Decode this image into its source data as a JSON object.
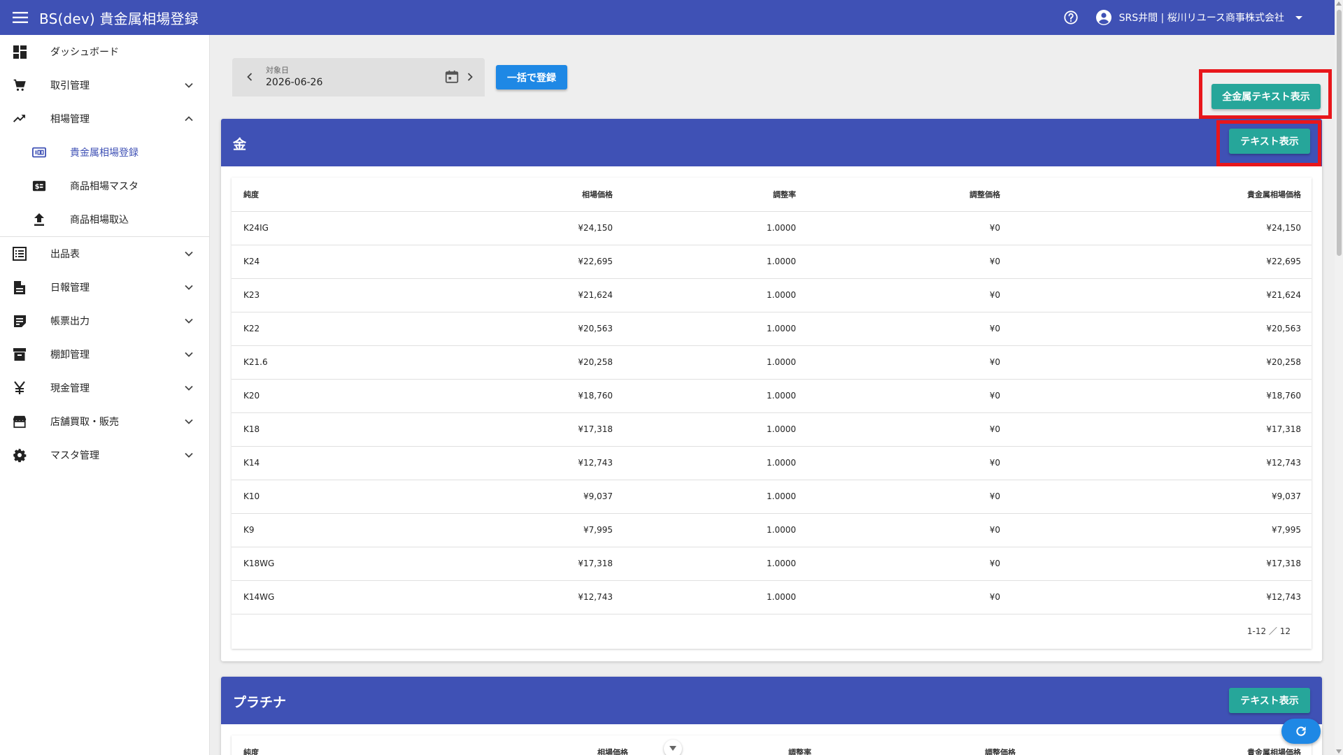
{
  "appbar": {
    "title": "BS(dev) 貴金属相場登録",
    "user_label": "SRS井間 | 桜川リユース商事株式会社"
  },
  "sidebar": {
    "items": [
      {
        "label": "ダッシュボード",
        "icon": "dashboard-icon"
      },
      {
        "label": "取引管理",
        "icon": "cart-icon"
      },
      {
        "label": "相場管理",
        "icon": "trending-up-icon"
      },
      {
        "label": "貴金属相場登録",
        "icon": "counter-icon"
      },
      {
        "label": "商品相場マスタ",
        "icon": "currency-card-icon"
      },
      {
        "label": "商品相場取込",
        "icon": "upload-icon"
      },
      {
        "label": "出品表",
        "icon": "list-icon"
      },
      {
        "label": "日報管理",
        "icon": "document-icon"
      },
      {
        "label": "帳票出力",
        "icon": "note-icon"
      },
      {
        "label": "棚卸管理",
        "icon": "archive-icon"
      },
      {
        "label": "現金管理",
        "icon": "yen-icon"
      },
      {
        "label": "店舗買取・販売",
        "icon": "store-icon"
      },
      {
        "label": "マスタ管理",
        "icon": "gear-icon"
      }
    ]
  },
  "toolbar": {
    "date_label": "対象日",
    "date_value": "2026-06-26",
    "bulk_register": "一括で登録",
    "all_metal_text": "全金属テキスト表示"
  },
  "gold": {
    "title": "金",
    "text_button": "テキスト表示",
    "columns": [
      "純度",
      "相場価格",
      "調整率",
      "調整価格",
      "貴金属相場価格"
    ],
    "rows": [
      [
        "K24IG",
        "¥24,150",
        "1.0000",
        "¥0",
        "¥24,150"
      ],
      [
        "K24",
        "¥22,695",
        "1.0000",
        "¥0",
        "¥22,695"
      ],
      [
        "K23",
        "¥21,624",
        "1.0000",
        "¥0",
        "¥21,624"
      ],
      [
        "K22",
        "¥20,563",
        "1.0000",
        "¥0",
        "¥20,563"
      ],
      [
        "K21.6",
        "¥20,258",
        "1.0000",
        "¥0",
        "¥20,258"
      ],
      [
        "K20",
        "¥18,760",
        "1.0000",
        "¥0",
        "¥18,760"
      ],
      [
        "K18",
        "¥17,318",
        "1.0000",
        "¥0",
        "¥17,318"
      ],
      [
        "K14",
        "¥12,743",
        "1.0000",
        "¥0",
        "¥12,743"
      ],
      [
        "K10",
        "¥9,037",
        "1.0000",
        "¥0",
        "¥9,037"
      ],
      [
        "K9",
        "¥7,995",
        "1.0000",
        "¥0",
        "¥7,995"
      ],
      [
        "K18WG",
        "¥17,318",
        "1.0000",
        "¥0",
        "¥17,318"
      ],
      [
        "K14WG",
        "¥12,743",
        "1.0000",
        "¥0",
        "¥12,743"
      ]
    ],
    "pager": "1-12 ／ 12"
  },
  "platinum": {
    "title": "プラチナ",
    "text_button": "テキスト表示",
    "columns": [
      "純度",
      "相場価格",
      "調整率",
      "調整価格",
      "貴金属相場価格"
    ]
  },
  "colors": {
    "primary": "#3f51b5",
    "accent_blue": "#1e88e5",
    "teal": "#26a69a",
    "highlight": "#e8161b"
  }
}
